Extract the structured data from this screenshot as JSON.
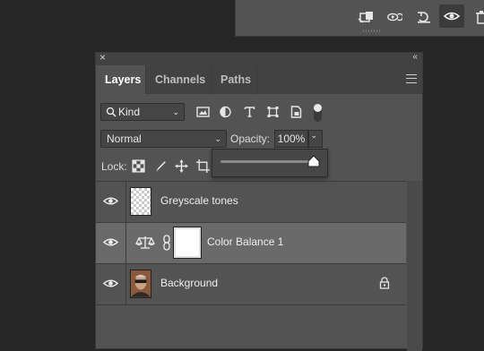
{
  "colors": {
    "panel_bg": "#535353",
    "tab_bar_bg": "#424242",
    "selected_row": "#6a6a6a",
    "desktop_bg": "#262626"
  },
  "top_panel": {
    "icons": [
      "delete-adjustment-clip-icon",
      "view-previous-state-icon",
      "reset-icon",
      "visibility-icon",
      "trash-icon"
    ]
  },
  "panel": {
    "close_glyph": "×",
    "collapse_glyph": "‹‹",
    "tabs": [
      {
        "label": "Layers",
        "active": true
      },
      {
        "label": "Channels",
        "active": false
      },
      {
        "label": "Paths",
        "active": false
      }
    ],
    "filter": {
      "kind_label": "Kind",
      "icons": [
        "pixel-filter-icon",
        "adjustment-filter-icon",
        "type-filter-icon",
        "shape-filter-icon",
        "smart-object-filter-icon"
      ]
    },
    "blend_mode": "Normal",
    "opacity_label": "Opacity:",
    "opacity_value": "100%",
    "opacity_slider_level": 1.0,
    "lock_label": "Lock:",
    "lock_icons": [
      "lock-transparent-pixels-icon",
      "lock-image-pixels-icon",
      "lock-position-icon",
      "lock-artboard-icon"
    ],
    "layers": [
      {
        "name": "Greyscale tones",
        "type": "pixel",
        "visible": true,
        "selected": false
      },
      {
        "name": "Color Balance 1",
        "type": "adjustment",
        "visible": true,
        "selected": true
      },
      {
        "name": "Background",
        "type": "photo",
        "visible": true,
        "selected": false,
        "locked": true
      }
    ]
  }
}
